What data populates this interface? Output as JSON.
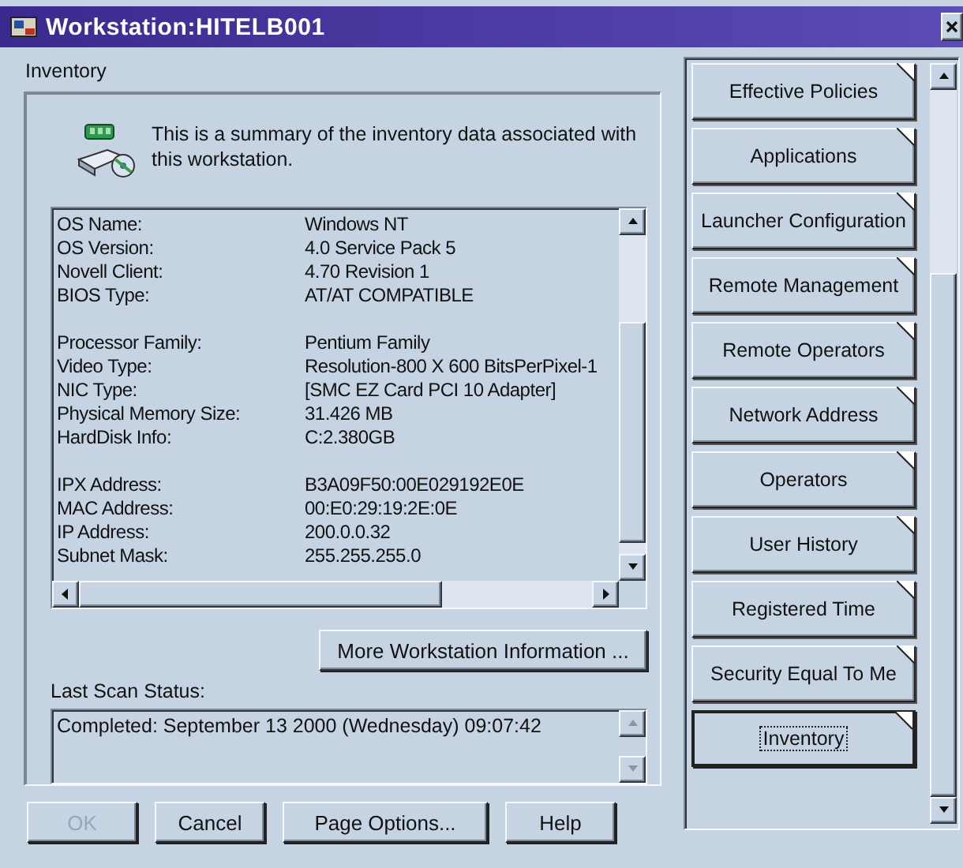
{
  "window": {
    "title": "Workstation:HITELB001"
  },
  "page_title": "Inventory",
  "summary": "This is a summary of the inventory data associated with this workstation.",
  "inventory_groups": [
    [
      {
        "label": "OS Name:",
        "value": "Windows NT"
      },
      {
        "label": "OS Version:",
        "value": "4.0 Service Pack 5"
      },
      {
        "label": "Novell Client:",
        "value": "4.70 Revision 1"
      },
      {
        "label": "BIOS Type:",
        "value": "AT/AT COMPATIBLE"
      }
    ],
    [
      {
        "label": "Processor Family:",
        "value": "Pentium Family"
      },
      {
        "label": "Video Type:",
        "value": "Resolution-800 X 600 BitsPerPixel-1"
      },
      {
        "label": "NIC Type:",
        "value": "[SMC EZ Card PCI 10 Adapter]"
      },
      {
        "label": "Physical Memory Size:",
        "value": "31.426 MB"
      },
      {
        "label": "HardDisk Info:",
        "value": "C:2.380GB"
      }
    ],
    [
      {
        "label": "IPX Address:",
        "value": "B3A09F50:00E029192E0E"
      },
      {
        "label": "MAC Address:",
        "value": "00:E0:29:19:2E:0E"
      },
      {
        "label": "IP Address:",
        "value": "200.0.0.32"
      },
      {
        "label": "Subnet Mask:",
        "value": "255.255.255.0"
      }
    ]
  ],
  "more_button": "More Workstation Information ...",
  "last_scan_label": "Last Scan Status:",
  "last_scan_status": "Completed:  September 13 2000 (Wednesday) 09:07:42",
  "pages": [
    {
      "label": "Effective Policies",
      "selected": false
    },
    {
      "label": "Applications",
      "selected": false
    },
    {
      "label": "Launcher Configuration",
      "selected": false
    },
    {
      "label": "Remote Management",
      "selected": false
    },
    {
      "label": "Remote Operators",
      "selected": false
    },
    {
      "label": "Network Address",
      "selected": false
    },
    {
      "label": "Operators",
      "selected": false
    },
    {
      "label": "User History",
      "selected": false
    },
    {
      "label": "Registered Time",
      "selected": false
    },
    {
      "label": "Security Equal To Me",
      "selected": false
    },
    {
      "label": "Inventory",
      "selected": true
    }
  ],
  "buttons": [
    {
      "label": "OK",
      "disabled": true
    },
    {
      "label": "Cancel",
      "disabled": false
    },
    {
      "label": "Page Options...",
      "disabled": false
    },
    {
      "label": "Help",
      "disabled": false
    }
  ]
}
